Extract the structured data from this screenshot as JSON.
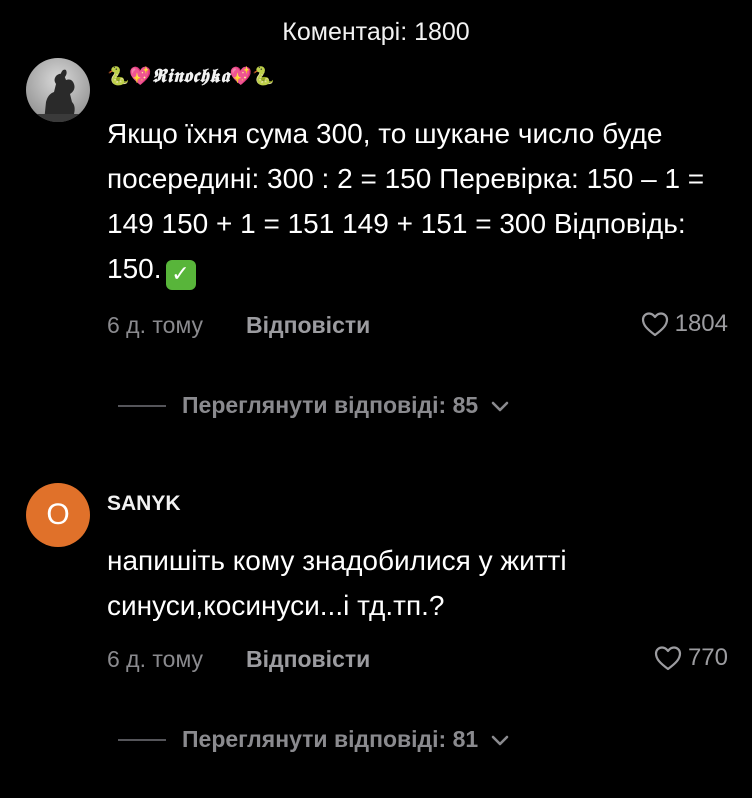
{
  "header": {
    "title": "Коментарі: 1800"
  },
  "comments": [
    {
      "username_prefix": "🐍💖",
      "username": "𝕽𝖎𝖓𝖔𝖈𝖍𝖐𝖆",
      "username_suffix": "💖🐍",
      "avatar_icon": "horse-rider-statue",
      "body": "Якщо їхня сума 300, то шукане число буде посередині: 300 : 2 = 150 Перевірка: 150 – 1 = 149 150 + 1 = 151 149 + 151 = 300 Відповідь: 150.",
      "body_emoji": "✓",
      "time": "6 д. тому",
      "reply_label": "Відповісти",
      "likes": "1804",
      "view_replies": "Переглянути відповіді: 85"
    },
    {
      "username": "SANYK",
      "avatar_letter": "O",
      "avatar_color": "#e0712a",
      "body": "напишіть кому знадобилися у житті синуси,косинуси...і тд.тп.?",
      "time": "6 д. тому",
      "reply_label": "Відповісти",
      "likes": "770",
      "view_replies": "Переглянути відповіді: 81"
    }
  ]
}
